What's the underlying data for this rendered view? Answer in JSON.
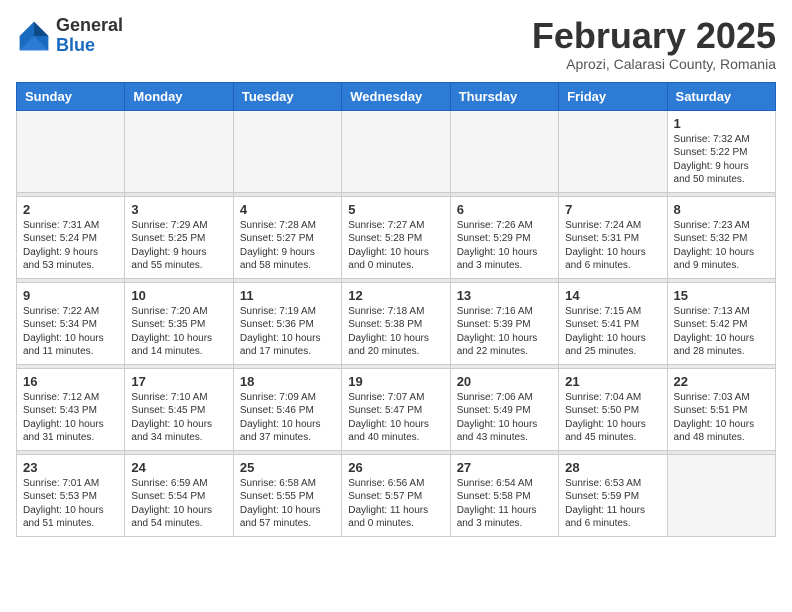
{
  "header": {
    "logo_general": "General",
    "logo_blue": "Blue",
    "month_title": "February 2025",
    "location": "Aprozi, Calarasi County, Romania"
  },
  "weekdays": [
    "Sunday",
    "Monday",
    "Tuesday",
    "Wednesday",
    "Thursday",
    "Friday",
    "Saturday"
  ],
  "weeks": [
    [
      {
        "day": "",
        "info": ""
      },
      {
        "day": "",
        "info": ""
      },
      {
        "day": "",
        "info": ""
      },
      {
        "day": "",
        "info": ""
      },
      {
        "day": "",
        "info": ""
      },
      {
        "day": "",
        "info": ""
      },
      {
        "day": "1",
        "info": "Sunrise: 7:32 AM\nSunset: 5:22 PM\nDaylight: 9 hours\nand 50 minutes."
      }
    ],
    [
      {
        "day": "2",
        "info": "Sunrise: 7:31 AM\nSunset: 5:24 PM\nDaylight: 9 hours\nand 53 minutes."
      },
      {
        "day": "3",
        "info": "Sunrise: 7:29 AM\nSunset: 5:25 PM\nDaylight: 9 hours\nand 55 minutes."
      },
      {
        "day": "4",
        "info": "Sunrise: 7:28 AM\nSunset: 5:27 PM\nDaylight: 9 hours\nand 58 minutes."
      },
      {
        "day": "5",
        "info": "Sunrise: 7:27 AM\nSunset: 5:28 PM\nDaylight: 10 hours\nand 0 minutes."
      },
      {
        "day": "6",
        "info": "Sunrise: 7:26 AM\nSunset: 5:29 PM\nDaylight: 10 hours\nand 3 minutes."
      },
      {
        "day": "7",
        "info": "Sunrise: 7:24 AM\nSunset: 5:31 PM\nDaylight: 10 hours\nand 6 minutes."
      },
      {
        "day": "8",
        "info": "Sunrise: 7:23 AM\nSunset: 5:32 PM\nDaylight: 10 hours\nand 9 minutes."
      }
    ],
    [
      {
        "day": "9",
        "info": "Sunrise: 7:22 AM\nSunset: 5:34 PM\nDaylight: 10 hours\nand 11 minutes."
      },
      {
        "day": "10",
        "info": "Sunrise: 7:20 AM\nSunset: 5:35 PM\nDaylight: 10 hours\nand 14 minutes."
      },
      {
        "day": "11",
        "info": "Sunrise: 7:19 AM\nSunset: 5:36 PM\nDaylight: 10 hours\nand 17 minutes."
      },
      {
        "day": "12",
        "info": "Sunrise: 7:18 AM\nSunset: 5:38 PM\nDaylight: 10 hours\nand 20 minutes."
      },
      {
        "day": "13",
        "info": "Sunrise: 7:16 AM\nSunset: 5:39 PM\nDaylight: 10 hours\nand 22 minutes."
      },
      {
        "day": "14",
        "info": "Sunrise: 7:15 AM\nSunset: 5:41 PM\nDaylight: 10 hours\nand 25 minutes."
      },
      {
        "day": "15",
        "info": "Sunrise: 7:13 AM\nSunset: 5:42 PM\nDaylight: 10 hours\nand 28 minutes."
      }
    ],
    [
      {
        "day": "16",
        "info": "Sunrise: 7:12 AM\nSunset: 5:43 PM\nDaylight: 10 hours\nand 31 minutes."
      },
      {
        "day": "17",
        "info": "Sunrise: 7:10 AM\nSunset: 5:45 PM\nDaylight: 10 hours\nand 34 minutes."
      },
      {
        "day": "18",
        "info": "Sunrise: 7:09 AM\nSunset: 5:46 PM\nDaylight: 10 hours\nand 37 minutes."
      },
      {
        "day": "19",
        "info": "Sunrise: 7:07 AM\nSunset: 5:47 PM\nDaylight: 10 hours\nand 40 minutes."
      },
      {
        "day": "20",
        "info": "Sunrise: 7:06 AM\nSunset: 5:49 PM\nDaylight: 10 hours\nand 43 minutes."
      },
      {
        "day": "21",
        "info": "Sunrise: 7:04 AM\nSunset: 5:50 PM\nDaylight: 10 hours\nand 45 minutes."
      },
      {
        "day": "22",
        "info": "Sunrise: 7:03 AM\nSunset: 5:51 PM\nDaylight: 10 hours\nand 48 minutes."
      }
    ],
    [
      {
        "day": "23",
        "info": "Sunrise: 7:01 AM\nSunset: 5:53 PM\nDaylight: 10 hours\nand 51 minutes."
      },
      {
        "day": "24",
        "info": "Sunrise: 6:59 AM\nSunset: 5:54 PM\nDaylight: 10 hours\nand 54 minutes."
      },
      {
        "day": "25",
        "info": "Sunrise: 6:58 AM\nSunset: 5:55 PM\nDaylight: 10 hours\nand 57 minutes."
      },
      {
        "day": "26",
        "info": "Sunrise: 6:56 AM\nSunset: 5:57 PM\nDaylight: 11 hours\nand 0 minutes."
      },
      {
        "day": "27",
        "info": "Sunrise: 6:54 AM\nSunset: 5:58 PM\nDaylight: 11 hours\nand 3 minutes."
      },
      {
        "day": "28",
        "info": "Sunrise: 6:53 AM\nSunset: 5:59 PM\nDaylight: 11 hours\nand 6 minutes."
      },
      {
        "day": "",
        "info": ""
      }
    ]
  ]
}
